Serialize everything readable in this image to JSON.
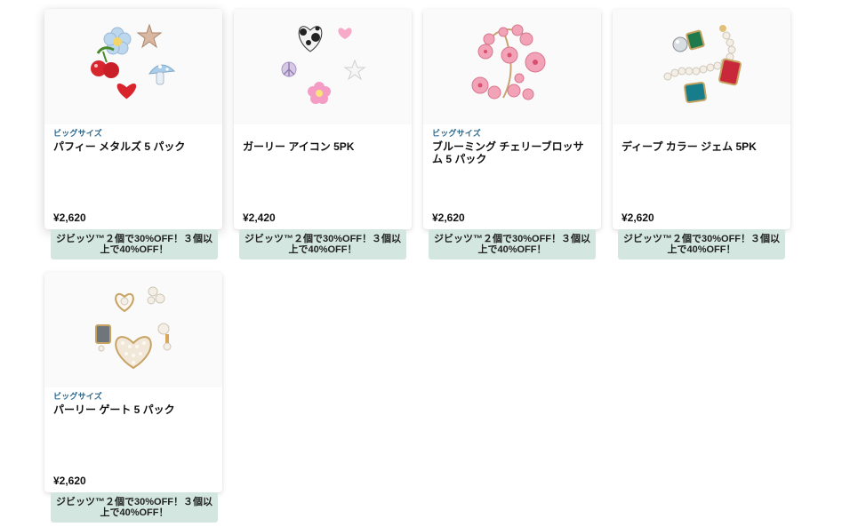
{
  "products": [
    {
      "badge": "ビッグサイズ",
      "title": "パフィー メタルズ 5 パック",
      "price": "¥2,620",
      "promo": "ジビッツ™２個で30%OFF！３個以上で40%OFF！"
    },
    {
      "badge": "",
      "title": "ガーリー アイコン 5PK",
      "price": "¥2,420",
      "promo": "ジビッツ™２個で30%OFF！３個以上で40%OFF！"
    },
    {
      "badge": "ビッグサイズ",
      "title": "ブルーミング チェリーブロッサム 5 パック",
      "price": "¥2,620",
      "promo": "ジビッツ™２個で30%OFF！３個以上で40%OFF！"
    },
    {
      "badge": "",
      "title": "ディープ カラー ジェム 5PK",
      "price": "¥2,620",
      "promo": "ジビッツ™２個で30%OFF！３個以上で40%OFF！"
    },
    {
      "badge": "ビッグサイズ",
      "title": "パーリー ゲート 5 パック",
      "price": "¥2,620",
      "promo": "ジビッツ™２個で30%OFF！３個以上で40%OFF！"
    }
  ],
  "colors": {
    "badge": "#2d6a8e",
    "promo_bg": "#d3e7e0"
  },
  "images": [
    "charms-puffy-metals-icon",
    "charms-girly-icons-icon",
    "charms-cherry-blossom-icon",
    "charms-deep-color-gems-icon",
    "charms-pearly-gate-icon"
  ]
}
